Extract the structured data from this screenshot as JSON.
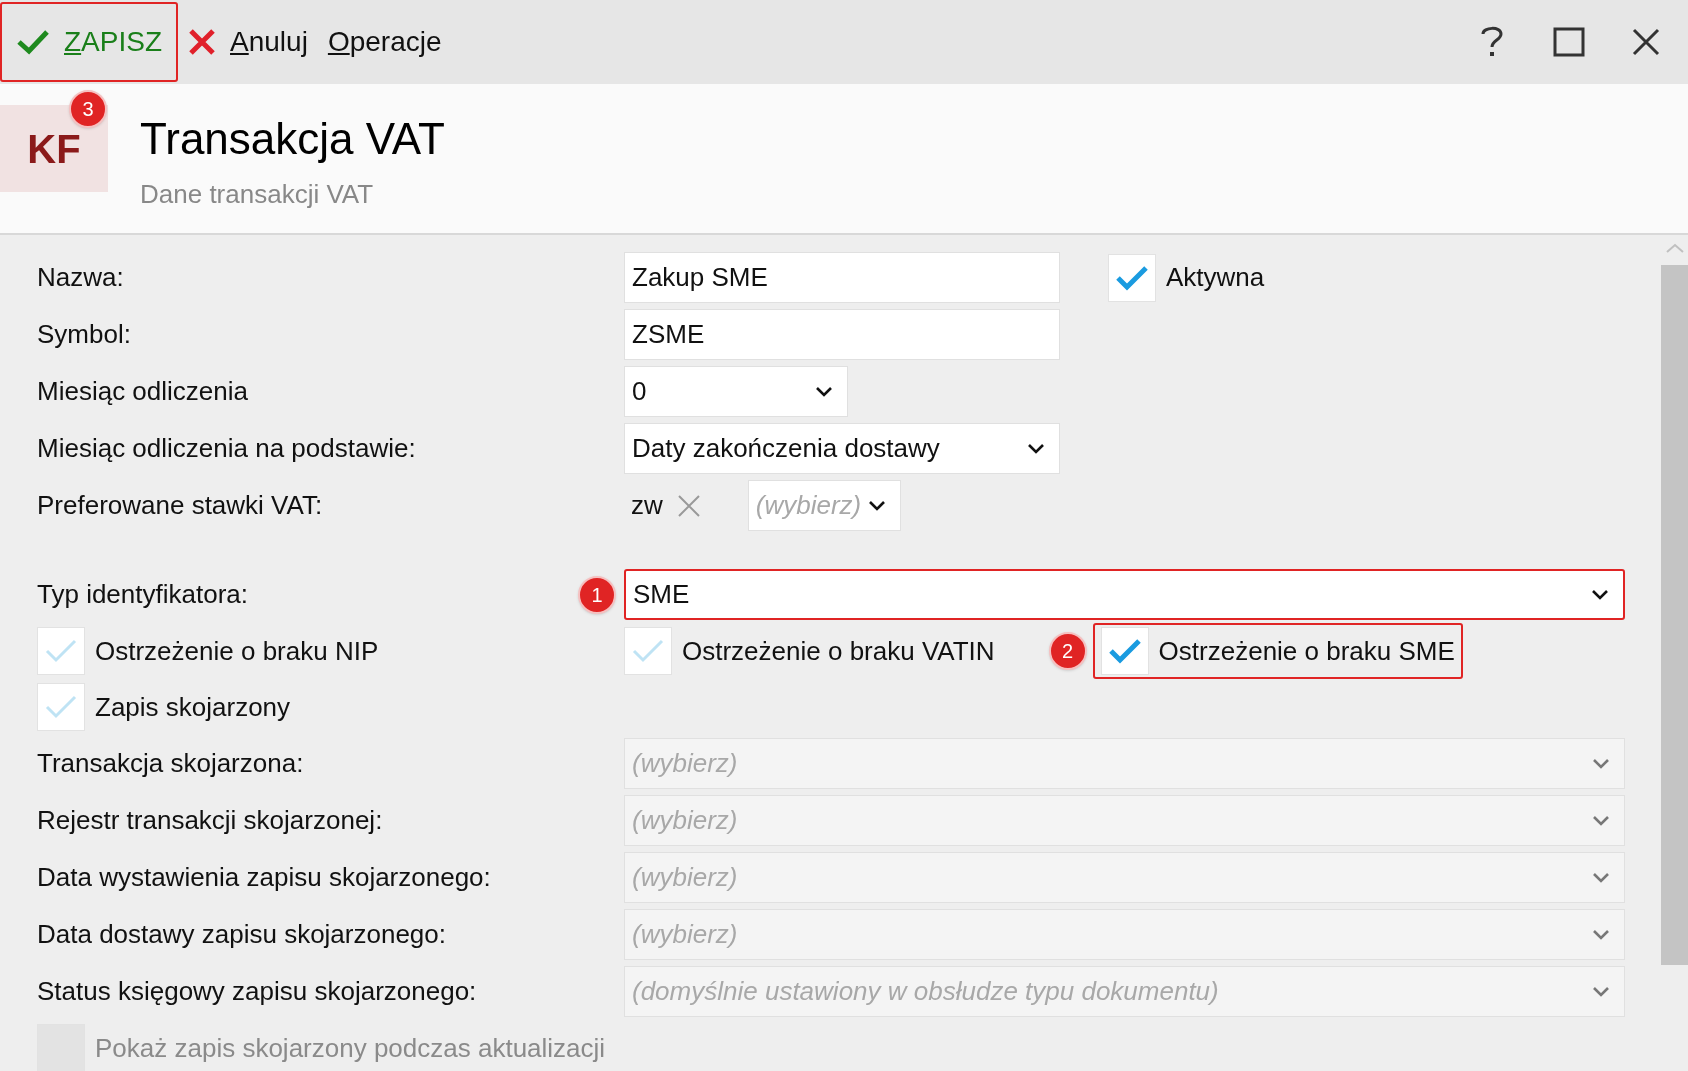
{
  "toolbar": {
    "buttons": [
      {
        "kind": "save",
        "mnemonic": "Z",
        "rest": "APISZ",
        "highlighted": true
      },
      {
        "kind": "cancel",
        "mnemonic": "A",
        "rest": "nuluj",
        "highlighted": false
      },
      {
        "kind": "menu",
        "mnemonic": "O",
        "rest": "peracje",
        "highlighted": false
      }
    ]
  },
  "header": {
    "logo": "KF",
    "badge": "3",
    "title": "Transakcja VAT",
    "subtitle": "Dane transakcji VAT"
  },
  "form": {
    "rows": [
      {
        "kind": "text",
        "label": "Nazwa:",
        "value": "Zakup SME",
        "checkbox": {
          "label": "Aktywna",
          "checked": true,
          "disabled": false
        }
      },
      {
        "kind": "text",
        "label": "Symbol:",
        "value": "ZSME"
      },
      {
        "kind": "select_short",
        "label": "Miesiąc odliczenia",
        "value": "0"
      },
      {
        "kind": "select_medium",
        "label": "Miesiąc odliczenia na podstawie:",
        "value": "Daty zakończenia dostawy"
      },
      {
        "kind": "tags",
        "label": "Preferowane stawki VAT:",
        "tags": [
          "zw"
        ],
        "placeholder": "(wybierz)"
      },
      {
        "kind": "select_wide",
        "label": "Typ identyfikatora:",
        "value": "SME",
        "disabled": false,
        "highlighted": true,
        "badge": "1"
      },
      {
        "kind": "checks",
        "items": [
          {
            "label": "Ostrzeżenie o braku NIP",
            "checked": false,
            "disabled": false,
            "highlighted": false
          },
          {
            "label": "Ostrzeżenie o braku VATIN",
            "checked": false,
            "disabled": false,
            "highlighted": false
          },
          {
            "label": "Ostrzeżenie o braku SME",
            "checked": true,
            "disabled": false,
            "highlighted": true,
            "badge": "2"
          }
        ]
      },
      {
        "kind": "checks",
        "items": [
          {
            "label": "Zapis skojarzony",
            "checked": false,
            "disabled": false,
            "highlighted": false
          }
        ]
      },
      {
        "kind": "select_wide",
        "label": "Transakcja skojarzona:",
        "placeholder": "(wybierz)",
        "disabled": true,
        "highlighted": false
      },
      {
        "kind": "select_wide",
        "label": "Rejestr transakcji skojarzonej:",
        "placeholder": "(wybierz)",
        "disabled": true,
        "highlighted": false
      },
      {
        "kind": "select_wide",
        "label": "Data wystawienia zapisu skojarzonego:",
        "placeholder": "(wybierz)",
        "disabled": true,
        "highlighted": false
      },
      {
        "kind": "select_wide",
        "label": "Data dostawy zapisu skojarzonego:",
        "placeholder": "(wybierz)",
        "disabled": true,
        "highlighted": false
      },
      {
        "kind": "select_wide",
        "label": "Status księgowy zapisu skojarzonego:",
        "placeholder": "(domyślnie ustawiony w obsłudze typu dokumentu)",
        "disabled": true,
        "highlighted": false
      },
      {
        "kind": "checks",
        "items": [
          {
            "label": "Pokaż zapis skojarzony podczas aktualizacji",
            "checked": false,
            "disabled": true,
            "highlighted": false
          }
        ]
      }
    ]
  }
}
